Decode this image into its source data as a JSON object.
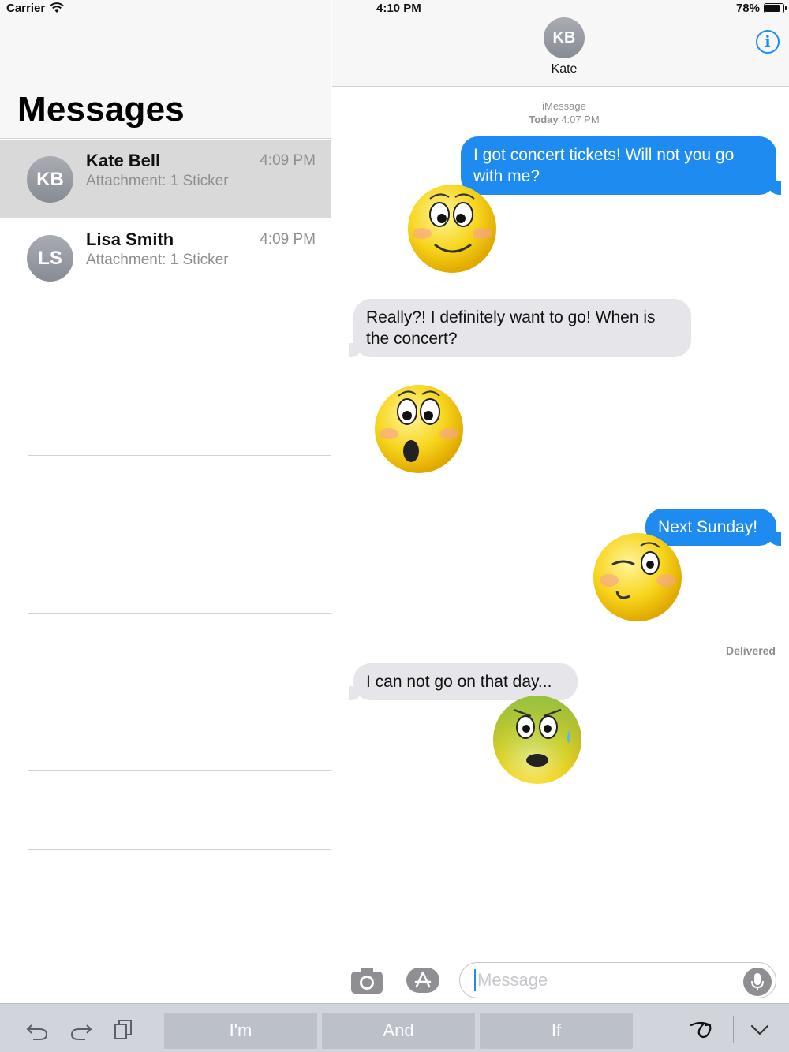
{
  "status_bar": {
    "carrier": "Carrier",
    "time": "4:10 PM",
    "battery": "78%"
  },
  "sidebar": {
    "title": "Messages",
    "conversations": [
      {
        "initials": "KB",
        "name": "Kate Bell",
        "time": "4:09 PM",
        "preview": "Attachment: 1 Sticker",
        "selected": true
      },
      {
        "initials": "LS",
        "name": "Lisa Smith",
        "time": "4:09 PM",
        "preview": "Attachment: 1 Sticker",
        "selected": false
      }
    ]
  },
  "chat": {
    "contact_initials": "KB",
    "contact_name": "Kate",
    "service": "iMessage",
    "date_bold": "Today",
    "date_time": "4:07 PM",
    "messages": [
      {
        "from": "me",
        "text": "I got concert tickets! Will not you go with me?"
      },
      {
        "from": "me",
        "sticker": "smiling-face"
      },
      {
        "from": "them",
        "text": "Really?! I definitely want to go! When is the concert?"
      },
      {
        "from": "them",
        "sticker": "surprised-face"
      },
      {
        "from": "me",
        "text": "Next Sunday!"
      },
      {
        "from": "me",
        "sticker": "winking-face"
      },
      {
        "from": "them",
        "text": "I can not go on that day..."
      },
      {
        "from": "them",
        "sticker": "worried-sweating-face"
      }
    ],
    "delivered": "Delivered",
    "input_placeholder": "Message"
  },
  "keyboard": {
    "suggestions": [
      "I'm",
      "And",
      "If"
    ]
  },
  "colors": {
    "outgoing_bubble": "#1e8bf0",
    "incoming_bubble": "#e5e5ea",
    "accent": "#1a8cff"
  }
}
